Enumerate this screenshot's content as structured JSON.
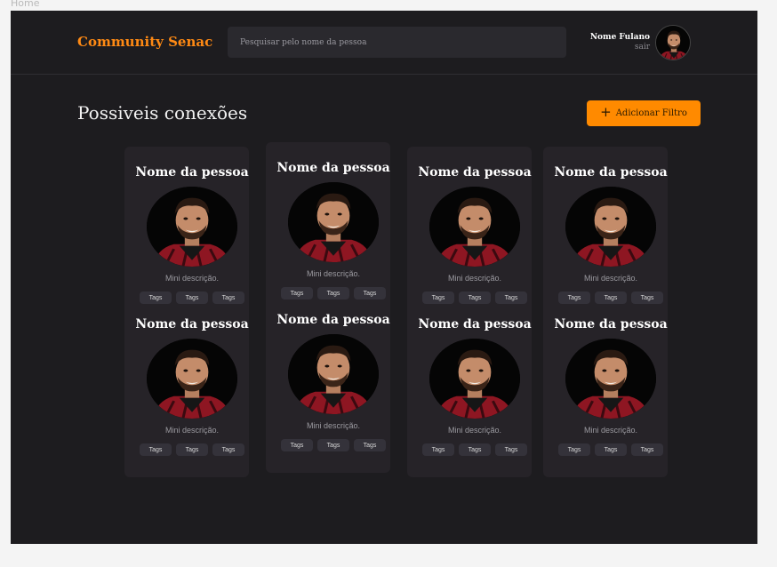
{
  "frame": {
    "label": "Home"
  },
  "header": {
    "brand": "Community Senac",
    "search_placeholder": "Pesquisar pelo nome da pessoa",
    "user_name": "Nome Fulano",
    "logout": "sair"
  },
  "main": {
    "title": "Possiveis conexões",
    "add_filter_label": "Adicionar Filtro",
    "cards": [
      {
        "name": "Nome da pessoa",
        "description": "Mini descrição.",
        "tags": [
          "Tags",
          "Tags",
          "Tags"
        ]
      },
      {
        "name": "Nome da pessoa",
        "description": "Mini descrição.",
        "tags": [
          "Tags",
          "Tags",
          "Tags"
        ]
      },
      {
        "name": "Nome da pessoa",
        "description": "Mini descrição.",
        "tags": [
          "Tags",
          "Tags",
          "Tags"
        ]
      },
      {
        "name": "Nome da pessoa",
        "description": "Mini descrição.",
        "tags": [
          "Tags",
          "Tags",
          "Tags"
        ]
      },
      {
        "name": "Nome da pessoa",
        "description": "Mini descrição.",
        "tags": [
          "Tags",
          "Tags",
          "Tags"
        ]
      },
      {
        "name": "Nome da pessoa",
        "description": "Mini descrição.",
        "tags": [
          "Tags",
          "Tags",
          "Tags"
        ]
      },
      {
        "name": "Nome da pessoa",
        "description": "Mini descrição.",
        "tags": [
          "Tags",
          "Tags",
          "Tags"
        ]
      },
      {
        "name": "Nome da pessoa",
        "description": "Mini descrição.",
        "tags": [
          "Tags",
          "Tags",
          "Tags"
        ]
      }
    ]
  },
  "colors": {
    "background": "#1d1c1f",
    "accent": "#ff8a00",
    "card": "#262328",
    "tag": "#34323a"
  }
}
